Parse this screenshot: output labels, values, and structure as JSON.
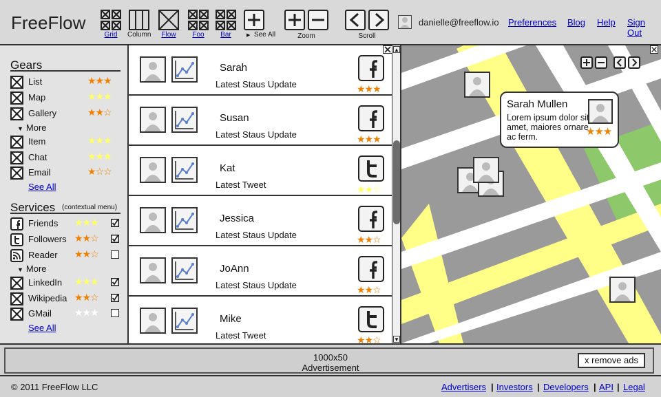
{
  "header": {
    "app_title": "FreeFlow",
    "tools": [
      {
        "label": "Grid",
        "icon": "grid-icon",
        "link": true
      },
      {
        "label": "Column",
        "icon": "column-icon",
        "link": false
      },
      {
        "label": "Flow",
        "icon": "flow-icon",
        "link": true
      },
      {
        "label": "Foo",
        "icon": "grid-icon",
        "link": true
      },
      {
        "label": "Bar",
        "icon": "grid-icon",
        "link": true
      },
      {
        "label": "See All",
        "icon": "plus-icon",
        "link": false
      }
    ],
    "zoom_label": "Zoom",
    "scroll_label": "Scroll",
    "user_email": "danielle@freeflow.io",
    "links": [
      "Preferences",
      "Blog",
      "Help",
      "Sign Out"
    ]
  },
  "sidebar": {
    "gears_title": "Gears",
    "gears": [
      {
        "name": "List",
        "stars": "★★★",
        "color": "#f08000"
      },
      {
        "name": "Map",
        "stars": "★★★",
        "color": "#ffff66"
      },
      {
        "name": "Gallery",
        "stars": "★★☆",
        "color": "#f08000"
      }
    ],
    "gears_more": "More",
    "gears_extra": [
      {
        "name": "Item",
        "stars": "★★★",
        "color": "#ffff66"
      },
      {
        "name": "Chat",
        "stars": "★★★",
        "color": "#ffff66"
      },
      {
        "name": "Email",
        "stars": "★☆☆",
        "color": "#f08000"
      }
    ],
    "gears_see_all": "See All",
    "services_title": "Services",
    "services_sub": "(contextual menu)",
    "services": [
      {
        "name": "Friends",
        "stars": "★★★",
        "color": "#ffff66",
        "checked": true,
        "icon": "facebook-icon"
      },
      {
        "name": "Followers",
        "stars": "★★☆",
        "color": "#f08000",
        "checked": true,
        "icon": "twitter-icon"
      },
      {
        "name": "Reader",
        "stars": "★★☆",
        "color": "#f08000",
        "checked": false,
        "icon": "rss-icon"
      }
    ],
    "services_more": "More",
    "services_extra": [
      {
        "name": "LinkedIn",
        "stars": "★★★",
        "color": "#ffff66",
        "checked": true
      },
      {
        "name": "Wikipedia",
        "stars": "★★☆",
        "color": "#f08000",
        "checked": true
      },
      {
        "name": "GMail",
        "stars": "★★★",
        "color": "#ffffff",
        "checked": false
      }
    ],
    "services_see_all": "See All"
  },
  "feed": [
    {
      "name": "Sarah",
      "status": "Latest Staus Update",
      "network": "facebook",
      "stars": "★★★",
      "star_color": "#f08000"
    },
    {
      "name": "Susan",
      "status": "Latest Staus Update",
      "network": "facebook",
      "stars": "★★★",
      "star_color": "#f08000"
    },
    {
      "name": "Kat",
      "status": "Latest Tweet",
      "network": "twitter",
      "stars": "★★☆",
      "star_color": "#ffff66"
    },
    {
      "name": "Jessica",
      "status": "Latest Staus Update",
      "network": "facebook",
      "stars": "★★☆",
      "star_color": "#f08000"
    },
    {
      "name": "JoAnn",
      "status": "Latest Staus Update",
      "network": "facebook",
      "stars": "★★☆",
      "star_color": "#f08000"
    },
    {
      "name": "Mike",
      "status": "Latest Tweet",
      "network": "twitter",
      "stars": "★★☆",
      "star_color": "#f08000"
    }
  ],
  "map": {
    "tooltip_name": "Sarah Mullen",
    "tooltip_text": "Lorem ipsum dolor sit amet, maiores ornare ac ferm.",
    "tooltip_stars": "★★★"
  },
  "ad": {
    "size": "1000x50",
    "label": "Advertisement",
    "remove": "x remove ads"
  },
  "footer": {
    "copyright": "© 2011 FreeFlow LLC",
    "links": [
      "Advertisers",
      "Investors",
      "Developers",
      "API",
      "Legal"
    ]
  }
}
